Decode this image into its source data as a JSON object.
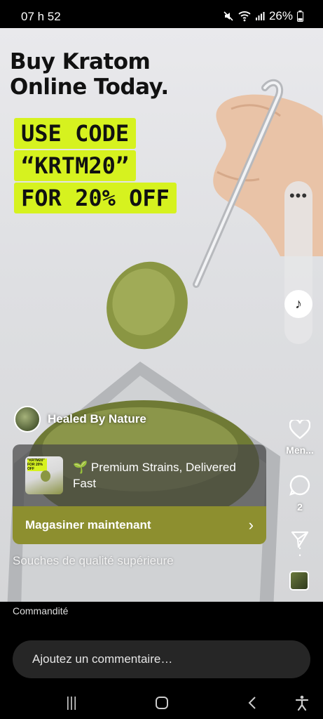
{
  "status_bar": {
    "time": "07 h 52",
    "battery": "26%",
    "icons": [
      "mute-icon",
      "wifi-icon",
      "signal-icon",
      "battery-icon"
    ]
  },
  "ad_image": {
    "headline_lines": [
      "Buy Kratom",
      "Online Today."
    ],
    "promo_lines": [
      "USE CODE",
      "“KRTM20”",
      "FOR 20% OFF"
    ],
    "promo_color": "#d6f21f"
  },
  "account": {
    "name": "Healed By Nature"
  },
  "ad_card": {
    "text_line1": "🌱 Premium Strains, Delivered",
    "text_line2": "Fast",
    "thumb_text": "\"KRTM20\" FOR 20% OFF",
    "cta_label": "Magasiner maintenant",
    "cta_color": "#8d8f2f"
  },
  "caption": "Souches de qualité supérieure",
  "side_actions": {
    "like_label": "Men...",
    "comment_count": "2"
  },
  "footer": {
    "sponsored": "Commandité",
    "comment_placeholder": "Ajoutez un commentaire…"
  }
}
